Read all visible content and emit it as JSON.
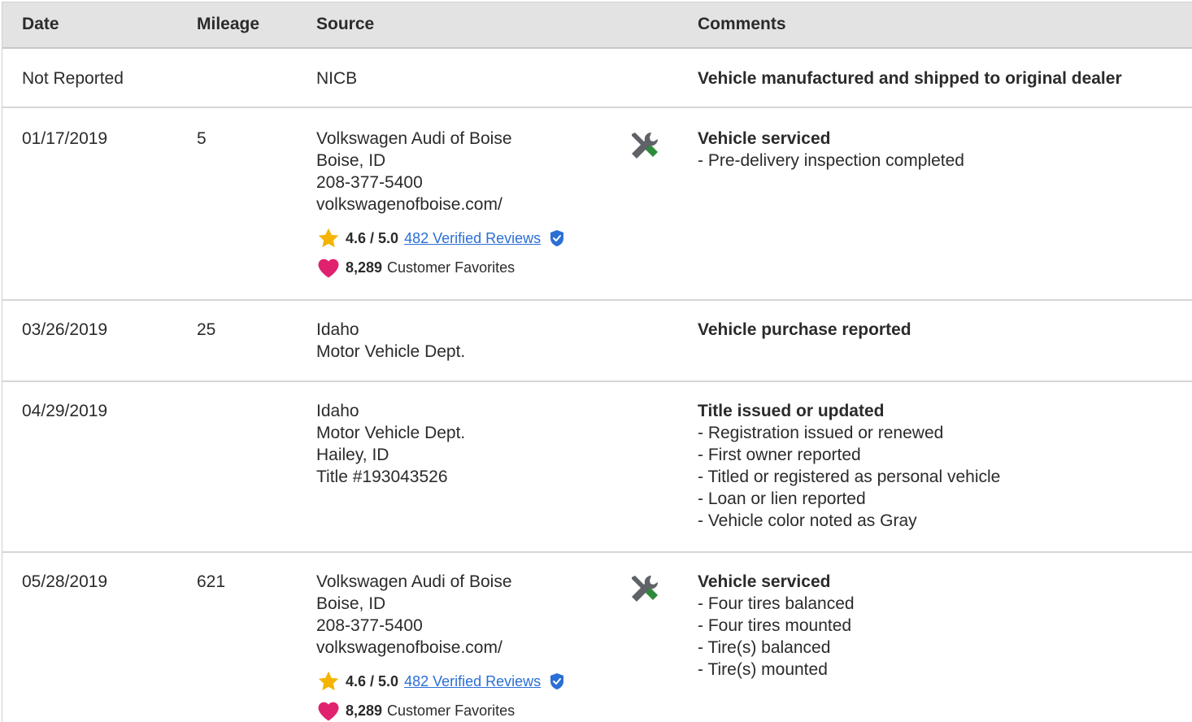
{
  "header": {
    "date": "Date",
    "mileage": "Mileage",
    "source": "Source",
    "comments": "Comments"
  },
  "rows": [
    {
      "date": "Not Reported",
      "mileage": "",
      "source": [
        "NICB"
      ],
      "comment_title": "Vehicle manufactured and shipped to original dealer",
      "comment_lines": []
    },
    {
      "date": "01/17/2019",
      "mileage": "5",
      "source": [
        "Volkswagen Audi of Boise",
        "Boise, ID",
        "208-377-5400",
        "volkswagenofboise.com/"
      ],
      "rating": "4.6 / 5.0",
      "reviews": "482 Verified Reviews",
      "favorites": "8,289",
      "favorites_label": "Customer Favorites",
      "icon": "wrench-screwdriver-icon",
      "comment_title": "Vehicle serviced",
      "comment_lines": [
        "- Pre-delivery inspection completed"
      ]
    },
    {
      "date": "03/26/2019",
      "mileage": "25",
      "source": [
        "Idaho",
        "Motor Vehicle Dept."
      ],
      "comment_title": "Vehicle purchase reported",
      "comment_lines": []
    },
    {
      "date": "04/29/2019",
      "mileage": "",
      "source": [
        "Idaho",
        "Motor Vehicle Dept.",
        "Hailey, ID",
        "Title #193043526"
      ],
      "comment_title": "Title issued or updated",
      "comment_lines": [
        "- Registration issued or renewed",
        "- First owner reported",
        "- Titled or registered as personal vehicle",
        "- Loan or lien reported",
        "- Vehicle color noted as Gray"
      ]
    },
    {
      "date": "05/28/2019",
      "mileage": "621",
      "source": [
        "Volkswagen Audi of Boise",
        "Boise, ID",
        "208-377-5400",
        "volkswagenofboise.com/"
      ],
      "rating": "4.6 / 5.0",
      "reviews": "482 Verified Reviews",
      "favorites": "8,289",
      "favorites_label": "Customer Favorites",
      "icon": "wrench-screwdriver-icon",
      "comment_title": "Vehicle serviced",
      "comment_lines": [
        "- Four tires balanced",
        "- Four tires mounted",
        "- Tire(s) balanced",
        "- Tire(s) mounted"
      ]
    }
  ],
  "colors": {
    "header_bg": "#e3e3e3",
    "link": "#2b6fd6",
    "star": "#f4b400",
    "heart": "#e0226e",
    "verified": "#2b6fd6",
    "wrench": "#5f6368",
    "screwdriver": "#2e8b3a"
  }
}
